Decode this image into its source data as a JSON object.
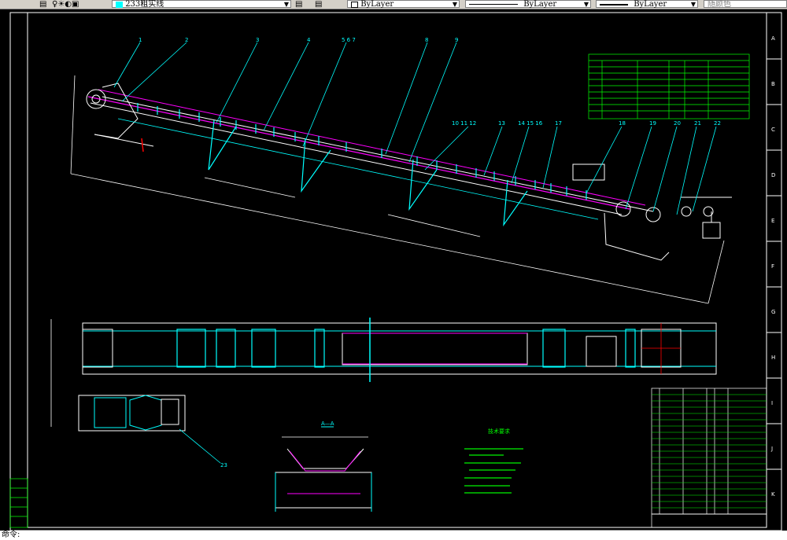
{
  "toolbar": {
    "layer_name": "233粗实线",
    "color_value": "ByLayer",
    "linetype_value": "ByLayer",
    "lineweight_value": "ByLayer",
    "plotstyle_value": "随颜色"
  },
  "drawing": {
    "part_numbers": [
      "1",
      "2",
      "3",
      "4",
      "5 6 7",
      "8",
      "9",
      "10 11 12",
      "13",
      "14 15 16",
      "17",
      "18",
      "19",
      "20",
      "21",
      "22"
    ],
    "section_label": "A—A",
    "notes_title": "技术要求",
    "callout_label": "23",
    "border_letters_right": [
      "A",
      "B",
      "C",
      "D",
      "E",
      "F",
      "G",
      "H",
      "I",
      "J",
      "K"
    ]
  },
  "colors": {
    "background": "#000000",
    "white_lines": "#ffffff",
    "cyan_lines": "#00ffff",
    "green_lines": "#00ff00",
    "magenta_lines": "#ff00ff"
  },
  "command_line": {
    "prompt": "命令:"
  }
}
